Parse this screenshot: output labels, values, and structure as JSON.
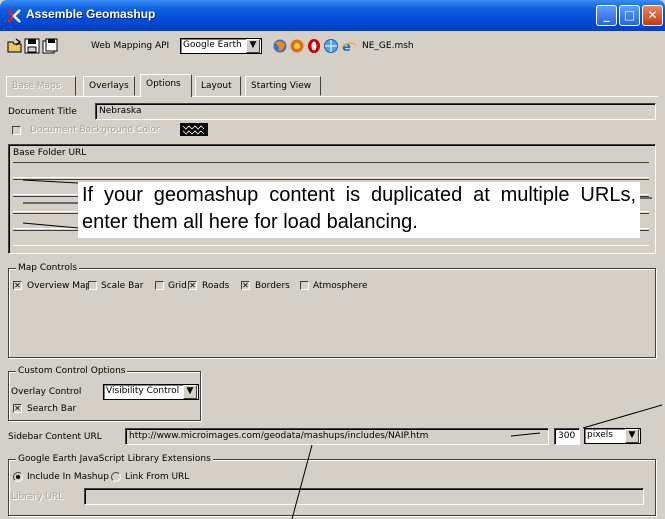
{
  "window": {
    "title": "Assemble Geomashup",
    "controls": {
      "minimize": "_",
      "maximize": "□",
      "close": "✕"
    }
  },
  "toolbar": {
    "api_label": "Web Mapping API",
    "api_value": "Google Earth",
    "file_name": "NE_GE.msh",
    "icons": [
      "open-folder-icon",
      "save-icon",
      "save-as-icon",
      "firefox-icon",
      "browser-icon",
      "opera-icon",
      "browser2-icon",
      "browser3-icon"
    ]
  },
  "tabs": [
    {
      "label": "Base Maps",
      "state": "disabled"
    },
    {
      "label": "Overlays",
      "state": "normal"
    },
    {
      "label": "Options",
      "state": "active"
    },
    {
      "label": "Layout",
      "state": "normal"
    },
    {
      "label": "Starting View",
      "state": "normal"
    }
  ],
  "document": {
    "title_label": "Document Title",
    "title_value": "Nebraska",
    "bg_color_label": "Document Background Color",
    "bg_color_swatch": "#000000"
  },
  "base_folder": {
    "label": "Base Folder URL",
    "rows": 6
  },
  "callout_text": "If your geomashup content is duplicated at multiple URLs, enter them all here for load balancing.",
  "map_controls": {
    "title": "Map Controls",
    "items": [
      {
        "label": "Overview Map",
        "checked": true
      },
      {
        "label": "Scale Bar",
        "checked": false
      },
      {
        "label": "Grid",
        "checked": false
      },
      {
        "label": "Roads",
        "checked": true
      },
      {
        "label": "Borders",
        "checked": true
      },
      {
        "label": "Atmosphere",
        "checked": false
      }
    ]
  },
  "custom_controls": {
    "title": "Custom Control Options",
    "overlay_label": "Overlay Control",
    "overlay_value": "Visibility Control",
    "search_bar_label": "Search Bar",
    "search_bar_checked": true
  },
  "sidebar": {
    "label": "Sidebar Content URL",
    "url": "http://www.microimages.com/geodata/mashups/includes/NAIP.htm",
    "size_value": "300",
    "unit_value": "pixels"
  },
  "js_extensions": {
    "title": "Google Earth JavaScript Library Extensions",
    "option1": "Include In Mashup",
    "option2": "Link From URL",
    "option1_selected": true,
    "library_label": "Library URL"
  }
}
